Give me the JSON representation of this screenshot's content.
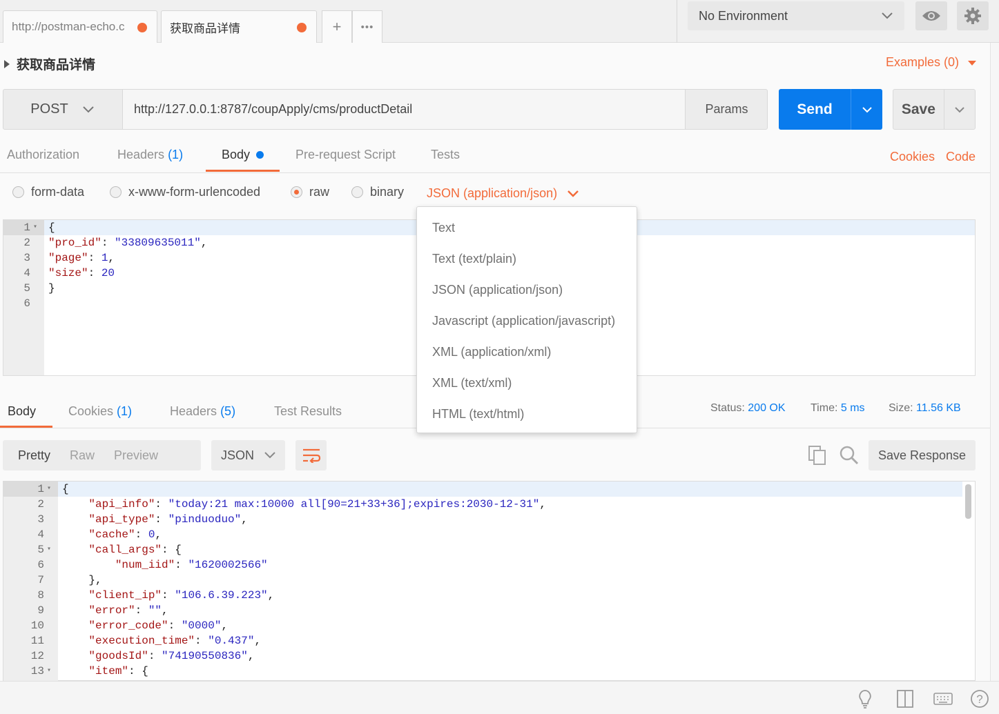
{
  "tabs": [
    {
      "label": "http://postman-echo.c",
      "unsaved": true
    },
    {
      "label": "获取商品详情",
      "unsaved": true
    }
  ],
  "tab_actions": {
    "new": "+",
    "more": "•••"
  },
  "environment": {
    "selected": "No Environment"
  },
  "request": {
    "name": "获取商品详情",
    "examples_label": "Examples (0)",
    "method": "POST",
    "url": "http://127.0.0.1:8787/coupApply/cms/productDetail",
    "params_label": "Params",
    "send_label": "Send",
    "save_label": "Save"
  },
  "request_tabs": {
    "authorization": "Authorization",
    "headers": "Headers",
    "headers_count": "(1)",
    "body": "Body",
    "prerequest": "Pre-request Script",
    "tests": "Tests",
    "cookies": "Cookies",
    "code": "Code"
  },
  "body_modes": {
    "form_data": "form-data",
    "urlencoded": "x-www-form-urlencoded",
    "raw": "raw",
    "binary": "binary",
    "selected": "raw",
    "content_type": "JSON (application/json)"
  },
  "content_type_options": [
    "Text",
    "Text (text/plain)",
    "JSON (application/json)",
    "Javascript (application/javascript)",
    "XML (application/xml)",
    "XML (text/xml)",
    "HTML (text/html)"
  ],
  "request_body": {
    "line_numbers": [
      "1",
      "2",
      "3",
      "4",
      "5",
      "6"
    ],
    "lines": [
      [
        {
          "t": "{",
          "c": "p"
        }
      ],
      [
        {
          "t": "\"pro_id\"",
          "c": "k"
        },
        {
          "t": ": ",
          "c": "p"
        },
        {
          "t": "\"33809635011\"",
          "c": "s"
        },
        {
          "t": ",",
          "c": "p"
        }
      ],
      [
        {
          "t": "\"page\"",
          "c": "k"
        },
        {
          "t": ": ",
          "c": "p"
        },
        {
          "t": "1",
          "c": "n"
        },
        {
          "t": ",",
          "c": "p"
        }
      ],
      [
        {
          "t": "\"size\"",
          "c": "k"
        },
        {
          "t": ": ",
          "c": "p"
        },
        {
          "t": "20",
          "c": "n"
        }
      ],
      [
        {
          "t": "}",
          "c": "p"
        }
      ],
      []
    ]
  },
  "response_tabs": {
    "body": "Body",
    "cookies": "Cookies",
    "cookies_count": "(1)",
    "headers": "Headers",
    "headers_count": "(5)",
    "test_results": "Test Results"
  },
  "response_meta": {
    "status_label": "Status:",
    "status_value": "200 OK",
    "time_label": "Time:",
    "time_value": "5 ms",
    "size_label": "Size:",
    "size_value": "11.56 KB"
  },
  "response_view": {
    "pretty": "Pretty",
    "raw": "Raw",
    "preview": "Preview",
    "format": "JSON",
    "save_response": "Save Response"
  },
  "response_body": {
    "line_numbers": [
      "1",
      "2",
      "3",
      "4",
      "5",
      "6",
      "7",
      "8",
      "9",
      "10",
      "11",
      "12",
      "13"
    ],
    "fold_lines": [
      1,
      5,
      13
    ],
    "lines": [
      [
        {
          "t": "{",
          "c": "p"
        }
      ],
      [
        {
          "t": "    ",
          "c": "p"
        },
        {
          "t": "\"api_info\"",
          "c": "k"
        },
        {
          "t": ": ",
          "c": "p"
        },
        {
          "t": "\"today:21 max:10000 all[90=21+33+36];expires:2030-12-31\"",
          "c": "s"
        },
        {
          "t": ",",
          "c": "p"
        }
      ],
      [
        {
          "t": "    ",
          "c": "p"
        },
        {
          "t": "\"api_type\"",
          "c": "k"
        },
        {
          "t": ": ",
          "c": "p"
        },
        {
          "t": "\"pinduoduo\"",
          "c": "s"
        },
        {
          "t": ",",
          "c": "p"
        }
      ],
      [
        {
          "t": "    ",
          "c": "p"
        },
        {
          "t": "\"cache\"",
          "c": "k"
        },
        {
          "t": ": ",
          "c": "p"
        },
        {
          "t": "0",
          "c": "n"
        },
        {
          "t": ",",
          "c": "p"
        }
      ],
      [
        {
          "t": "    ",
          "c": "p"
        },
        {
          "t": "\"call_args\"",
          "c": "k"
        },
        {
          "t": ": {",
          "c": "p"
        }
      ],
      [
        {
          "t": "        ",
          "c": "p"
        },
        {
          "t": "\"num_iid\"",
          "c": "k"
        },
        {
          "t": ": ",
          "c": "p"
        },
        {
          "t": "\"1620002566\"",
          "c": "s"
        }
      ],
      [
        {
          "t": "    },",
          "c": "p"
        }
      ],
      [
        {
          "t": "    ",
          "c": "p"
        },
        {
          "t": "\"client_ip\"",
          "c": "k"
        },
        {
          "t": ": ",
          "c": "p"
        },
        {
          "t": "\"106.6.39.223\"",
          "c": "s"
        },
        {
          "t": ",",
          "c": "p"
        }
      ],
      [
        {
          "t": "    ",
          "c": "p"
        },
        {
          "t": "\"error\"",
          "c": "k"
        },
        {
          "t": ": ",
          "c": "p"
        },
        {
          "t": "\"\"",
          "c": "s"
        },
        {
          "t": ",",
          "c": "p"
        }
      ],
      [
        {
          "t": "    ",
          "c": "p"
        },
        {
          "t": "\"error_code\"",
          "c": "k"
        },
        {
          "t": ": ",
          "c": "p"
        },
        {
          "t": "\"0000\"",
          "c": "s"
        },
        {
          "t": ",",
          "c": "p"
        }
      ],
      [
        {
          "t": "    ",
          "c": "p"
        },
        {
          "t": "\"execution_time\"",
          "c": "k"
        },
        {
          "t": ": ",
          "c": "p"
        },
        {
          "t": "\"0.437\"",
          "c": "s"
        },
        {
          "t": ",",
          "c": "p"
        }
      ],
      [
        {
          "t": "    ",
          "c": "p"
        },
        {
          "t": "\"goodsId\"",
          "c": "k"
        },
        {
          "t": ": ",
          "c": "p"
        },
        {
          "t": "\"74190550836\"",
          "c": "s"
        },
        {
          "t": ",",
          "c": "p"
        }
      ],
      [
        {
          "t": "    ",
          "c": "p"
        },
        {
          "t": "\"item\"",
          "c": "k"
        },
        {
          "t": ": {",
          "c": "p"
        }
      ]
    ]
  },
  "colors": {
    "accent": "#f26b3a",
    "primary": "#097bed"
  }
}
